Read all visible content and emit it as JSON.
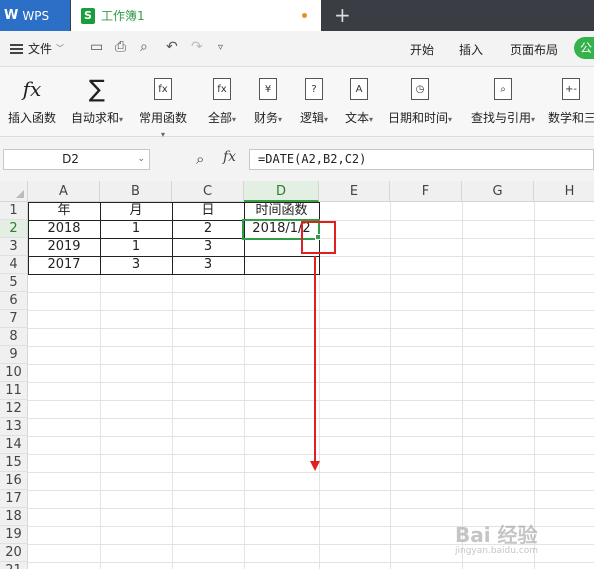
{
  "titlebar": {
    "app_name": "WPS",
    "doc_title": "工作簿1",
    "doc_icon": "S",
    "new_tab": "+"
  },
  "menu": {
    "file_label": "文件",
    "tabs": [
      "开始",
      "插入",
      "页面布局",
      "公"
    ]
  },
  "ribbon": {
    "buttons": [
      {
        "label": "插入函数",
        "icon": "fx-icon"
      },
      {
        "label": "自动求和",
        "icon": "sigma-icon",
        "caret": true
      },
      {
        "label": "常用函数",
        "icon": "star-fx-icon",
        "caret": true
      },
      {
        "label": "全部",
        "icon": "fx-box-icon",
        "caret": true
      },
      {
        "label": "财务",
        "icon": "yen-icon",
        "caret": true
      },
      {
        "label": "逻辑",
        "icon": "question-icon",
        "caret": true
      },
      {
        "label": "文本",
        "icon": "text-a-icon",
        "caret": true
      },
      {
        "label": "日期和时间",
        "icon": "clock-icon",
        "caret": true
      },
      {
        "label": "查找与引用",
        "icon": "search-doc-icon",
        "caret": true
      },
      {
        "label": "数学和三",
        "icon": "math-icon"
      }
    ],
    "icon_glyphs": {
      "fx": "fx",
      "sigma": "∑",
      "star_fx": "fx",
      "fx_box": "fx",
      "yen": "¥",
      "question": "?",
      "text_a": "A",
      "clock": "◷",
      "search": "⌕",
      "math": "+-"
    }
  },
  "formula_bar": {
    "name_box": "D2",
    "fx_label": "fx",
    "formula": "=DATE(A2,B2,C2)"
  },
  "sheet": {
    "columns": [
      "A",
      "B",
      "C",
      "D",
      "E",
      "F",
      "G",
      "H"
    ],
    "selected_column": "D",
    "rows": [
      "1",
      "2",
      "3",
      "4",
      "5",
      "6",
      "7",
      "8",
      "9",
      "10",
      "11",
      "12",
      "13",
      "14",
      "15",
      "16",
      "17",
      "18",
      "19",
      "20",
      "21"
    ],
    "selected_row": "2",
    "cells": {
      "A1": "年",
      "B1": "月",
      "C1": "日",
      "D1": "时间函数",
      "A2": "2018",
      "B2": "1",
      "C2": "2",
      "D2": "2018/1/2",
      "A3": "2019",
      "B3": "1",
      "C3": "3",
      "A4": "2017",
      "B4": "3",
      "C4": "3"
    }
  },
  "watermark": {
    "text": "Bai 经验",
    "url": "jingyan.baidu.com"
  },
  "colors": {
    "accent_green": "#2f9e44",
    "annotation_red": "#e02020",
    "titlebar_blue": "#2c6fc6"
  }
}
